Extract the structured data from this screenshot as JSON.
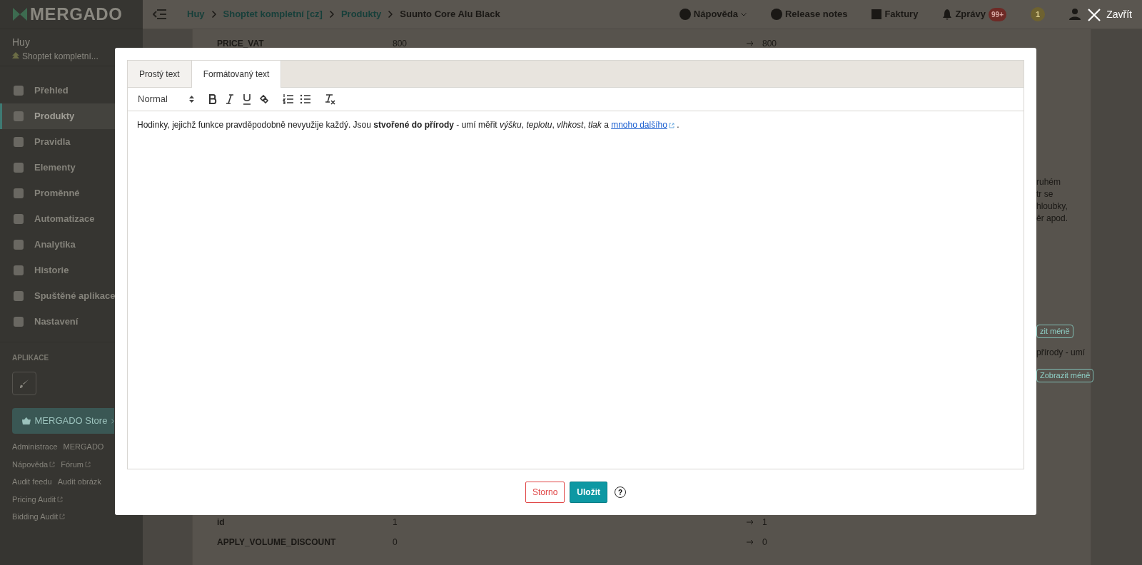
{
  "sidebar": {
    "logo": "MERGADO",
    "user": {
      "name": "Huy",
      "shop": "Shoptet kompletní..."
    },
    "items": [
      {
        "label": "Přehled",
        "selected": false
      },
      {
        "label": "Produkty",
        "selected": true
      },
      {
        "label": "Pravidla",
        "selected": false
      },
      {
        "label": "Elementy",
        "selected": false
      },
      {
        "label": "Proměnné",
        "selected": false
      },
      {
        "label": "Automatizace",
        "selected": false
      },
      {
        "label": "Analytika",
        "selected": false
      },
      {
        "label": "Historie",
        "selected": false
      },
      {
        "label": "Spuštěné aplikace",
        "selected": false
      },
      {
        "label": "Nastavení",
        "selected": false
      }
    ],
    "apps_heading": "APLIKACE",
    "store_button": "MERGADO Store",
    "links": [
      {
        "label": "Administrace",
        "external": false
      },
      {
        "label": "MERGADO",
        "external": false
      },
      {
        "label": "Nápověda",
        "external": true
      },
      {
        "label": "Fórum",
        "external": true
      },
      {
        "label": "Audit feedu",
        "external": false
      },
      {
        "label": "Audit obrázk",
        "external": false
      },
      {
        "label": "Pricing Audit",
        "external": true
      },
      {
        "label": "Bidding Audit",
        "external": true
      }
    ]
  },
  "header": {
    "breadcrumbs": [
      "Huy",
      "Shoptet kompletní [cz]",
      "Produkty",
      "Suunto Core Alu Black"
    ],
    "help": "Nápověda",
    "release_notes": "Release notes",
    "invoices": "Faktury",
    "messages": "Zprávy",
    "messages_badge": "99+",
    "notifications_badge": "1",
    "close": "Zavřít"
  },
  "product_table": {
    "top_rows": [
      {
        "name": "PRICE_VAT",
        "value": "800",
        "new_value": "800"
      }
    ],
    "bottom_rows": [
      {
        "name": "id",
        "value": "1",
        "new_value": "1"
      },
      {
        "name": "APPLY_VOLUME_DISCOUNT",
        "value": "0",
        "new_value": "0"
      }
    ]
  },
  "side_text": {
    "lines": [
      "ruhém",
      "tr se",
      "hloubky,",
      "ěr apod."
    ],
    "less_button_1": "zit méně",
    "snippet": "přírody - umí",
    "less_button_2": "Zobrazit méně"
  },
  "modal": {
    "tabs": [
      {
        "label": "Prostý text",
        "selected": false
      },
      {
        "label": "Formátovaný text",
        "selected": true
      }
    ],
    "format": "Normal",
    "content": {
      "text": "Hodinky, jejichž funkce pravděpodobně nevyužije každý. Jsou **stvořené do přírody** - umí měřit *výšku*, *teplotu*, *vlhkost*, *tlak* a ",
      "link": "mnoho dalšího",
      "after": " ."
    },
    "cancel": "Storno",
    "save": "Uložit",
    "help": "?"
  }
}
